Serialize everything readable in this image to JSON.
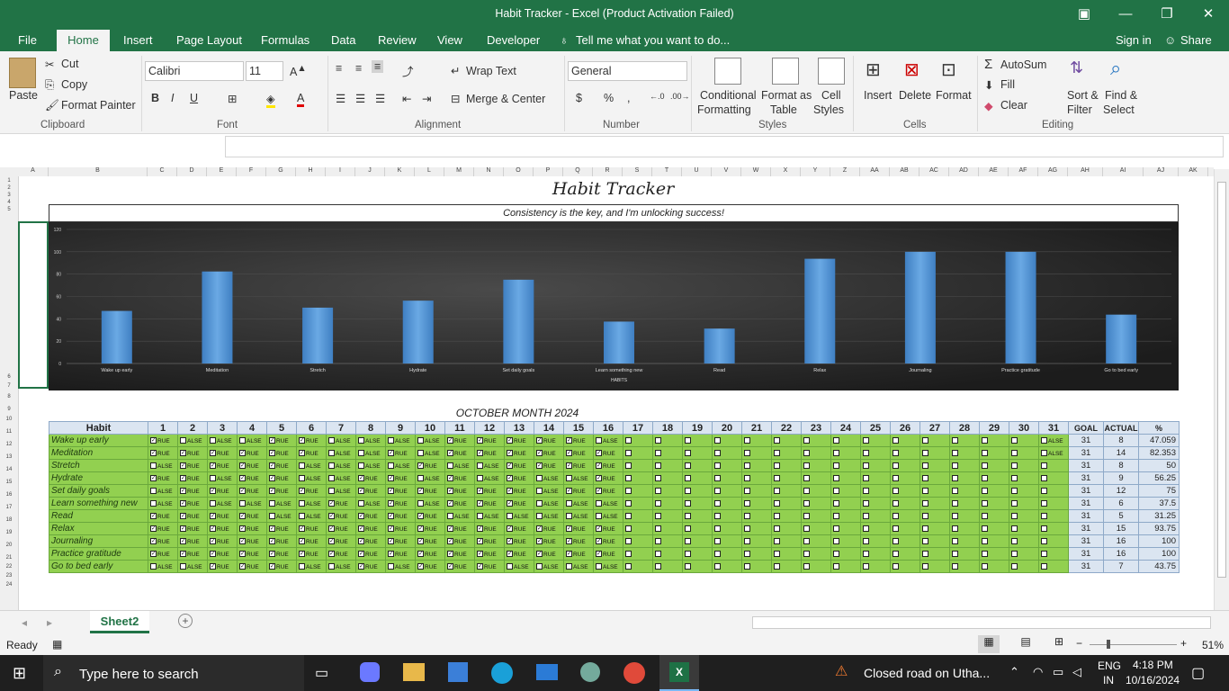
{
  "window": {
    "title": "Habit Tracker - Excel (Product Activation Failed)"
  },
  "tabs": [
    "File",
    "Home",
    "Insert",
    "Page Layout",
    "Formulas",
    "Data",
    "Review",
    "View",
    "Developer"
  ],
  "tell_me": "Tell me what you want to do...",
  "sign_in": "Sign in",
  "share": "Share",
  "clipboard": {
    "paste": "Paste",
    "cut": "Cut",
    "copy": "Copy",
    "format_painter": "Format Painter",
    "group": "Clipboard"
  },
  "font": {
    "name": "Calibri",
    "size": "11",
    "group": "Font"
  },
  "alignment": {
    "wrap": "Wrap Text",
    "merge": "Merge & Center",
    "group": "Alignment"
  },
  "number": {
    "format": "General",
    "group": "Number",
    "dollar": "$",
    "percent": "%",
    "comma": ","
  },
  "styles": {
    "conditional": "Conditional",
    "conditional2": "Formatting",
    "format_as": "Format as",
    "format_as2": "Table",
    "cell": "Cell",
    "cell2": "Styles",
    "group": "Styles"
  },
  "cells": {
    "insert": "Insert",
    "delete": "Delete",
    "format": "Format",
    "group": "Cells"
  },
  "editing": {
    "autosum": "AutoSum",
    "fill": "Fill",
    "clear": "Clear",
    "sort": "Sort &",
    "sort2": "Filter",
    "find": "Find &",
    "find2": "Select",
    "group": "Editing"
  },
  "sheet": {
    "title": "Habit Tracker",
    "subtitle": "Consistency is the key, and I'm unlocking success!",
    "month": "OCTOBER MONTH 2024",
    "header_habit": "Habit",
    "header_goal": "GOAL",
    "header_actual": "ACTUAL",
    "header_pct": "%"
  },
  "columns": [
    "A",
    "B",
    "C",
    "D",
    "E",
    "F",
    "G",
    "H",
    "I",
    "J",
    "K",
    "L",
    "M",
    "N",
    "O",
    "P",
    "Q",
    "R",
    "S",
    "T",
    "U",
    "V",
    "W",
    "X",
    "Y",
    "Z",
    "AA",
    "AB",
    "AC",
    "AD",
    "AE",
    "AF",
    "AG",
    "AH",
    "AI",
    "AJ",
    "AK"
  ],
  "habits": [
    {
      "name": "Wake up early",
      "goal": "31",
      "actual": "8",
      "pct": "47.059",
      "days": "TFFFTTFFFFTTTTTF"
    },
    {
      "name": "Meditation",
      "goal": "31",
      "actual": "14",
      "pct": "82.353",
      "days": "TTTTTTFFTFTTTTTT"
    },
    {
      "name": "Stretch",
      "goal": "31",
      "actual": "8",
      "pct": "50",
      "days": "FTTTTFFFFTFFTTTT"
    },
    {
      "name": "Hydrate",
      "goal": "31",
      "actual": "9",
      "pct": "56.25",
      "days": "TTFTTFFTTFTFTFFT"
    },
    {
      "name": "Set daily goals",
      "goal": "31",
      "actual": "12",
      "pct": "75",
      "days": "FTTTTTFTTTTTTFTT"
    },
    {
      "name": "Learn something new",
      "goal": "31",
      "actual": "6",
      "pct": "37.5",
      "days": "FTFFFFTFTFTTTFFF"
    },
    {
      "name": "Read",
      "goal": "31",
      "actual": "5",
      "pct": "31.25",
      "days": "TTTTFFTTTTFFFFFF"
    },
    {
      "name": "Relax",
      "goal": "31",
      "actual": "15",
      "pct": "93.75",
      "days": "TTTTTTTTTTTTTTTT"
    },
    {
      "name": "Journaling",
      "goal": "31",
      "actual": "16",
      "pct": "100",
      "days": "TTTTTTTTTTTTTTTT"
    },
    {
      "name": "Practice gratitude",
      "goal": "31",
      "actual": "16",
      "pct": "100",
      "days": "TTTTTTTTTTTTTTTT"
    },
    {
      "name": "Go to bed early",
      "goal": "31",
      "actual": "7",
      "pct": "43.75",
      "days": "FFTTTFFTFTTTFFFF"
    }
  ],
  "chart_data": {
    "type": "bar",
    "title": "",
    "xlabel": "HABITS",
    "ylim": [
      0,
      120
    ],
    "yticks": [
      0,
      20,
      40,
      60,
      80,
      100,
      120
    ],
    "categories": [
      "Wake up early",
      "Meditation",
      "Stretch",
      "Hydrate",
      "Set daily goals",
      "Learn something new",
      "Read",
      "Relax",
      "Journaling",
      "Practice gratitude",
      "Go to bed early"
    ],
    "values": [
      47.059,
      82.353,
      50,
      56.25,
      75,
      37.5,
      31.25,
      93.75,
      100,
      100,
      43.75
    ]
  },
  "sheet_tab": "Sheet2",
  "status": {
    "ready": "Ready",
    "zoom": "51%"
  },
  "taskbar": {
    "search": "Type here to search",
    "news": "Closed road on Utha...",
    "lang1": "ENG",
    "lang2": "IN",
    "time": "4:18 PM",
    "date": "10/16/2024"
  },
  "colors": {
    "excel_green": "#217346",
    "cell_green": "#92d050",
    "bar_blue": "#5b9bd5"
  }
}
